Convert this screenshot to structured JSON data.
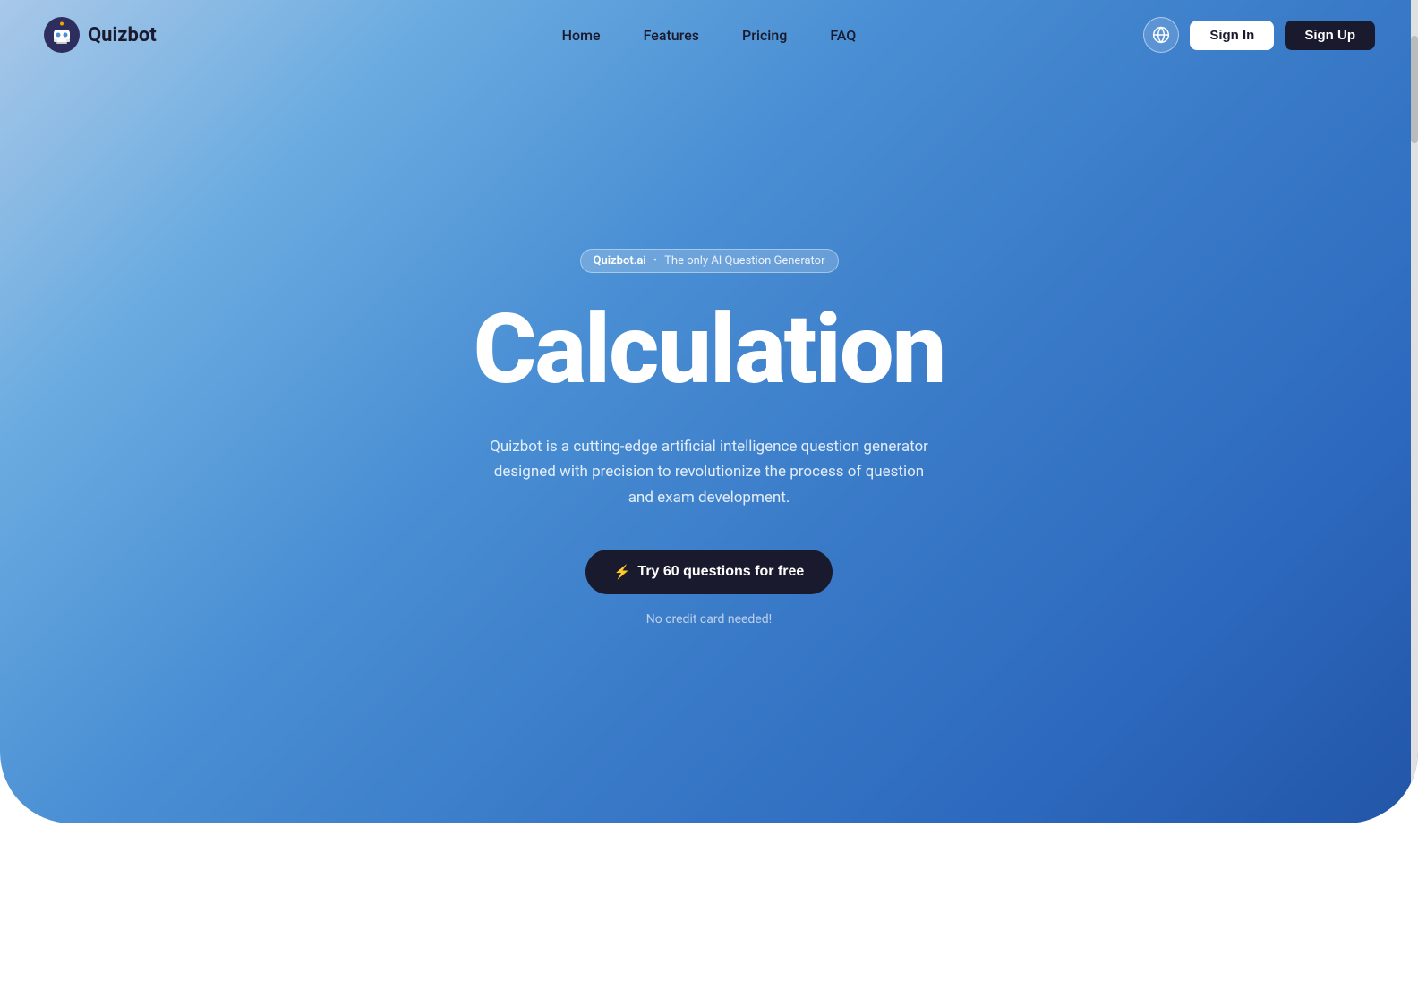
{
  "logo": {
    "text": "Quizbot"
  },
  "navbar": {
    "links": [
      {
        "label": "Home",
        "id": "home"
      },
      {
        "label": "Features",
        "id": "features"
      },
      {
        "label": "Pricing",
        "id": "pricing"
      },
      {
        "label": "FAQ",
        "id": "faq"
      }
    ],
    "sign_in": "Sign In",
    "sign_up": "Sign Up"
  },
  "hero": {
    "badge_brand": "Quizbot.ai",
    "badge_dot": "•",
    "badge_subtitle": "The only AI Question Generator",
    "title": "Calculation",
    "description": "Quizbot is a cutting-edge artificial intelligence question generator designed with precision to revolutionize the process of question and exam development.",
    "cta_label": "Try 60 questions for free",
    "no_cc": "No credit card needed!"
  }
}
